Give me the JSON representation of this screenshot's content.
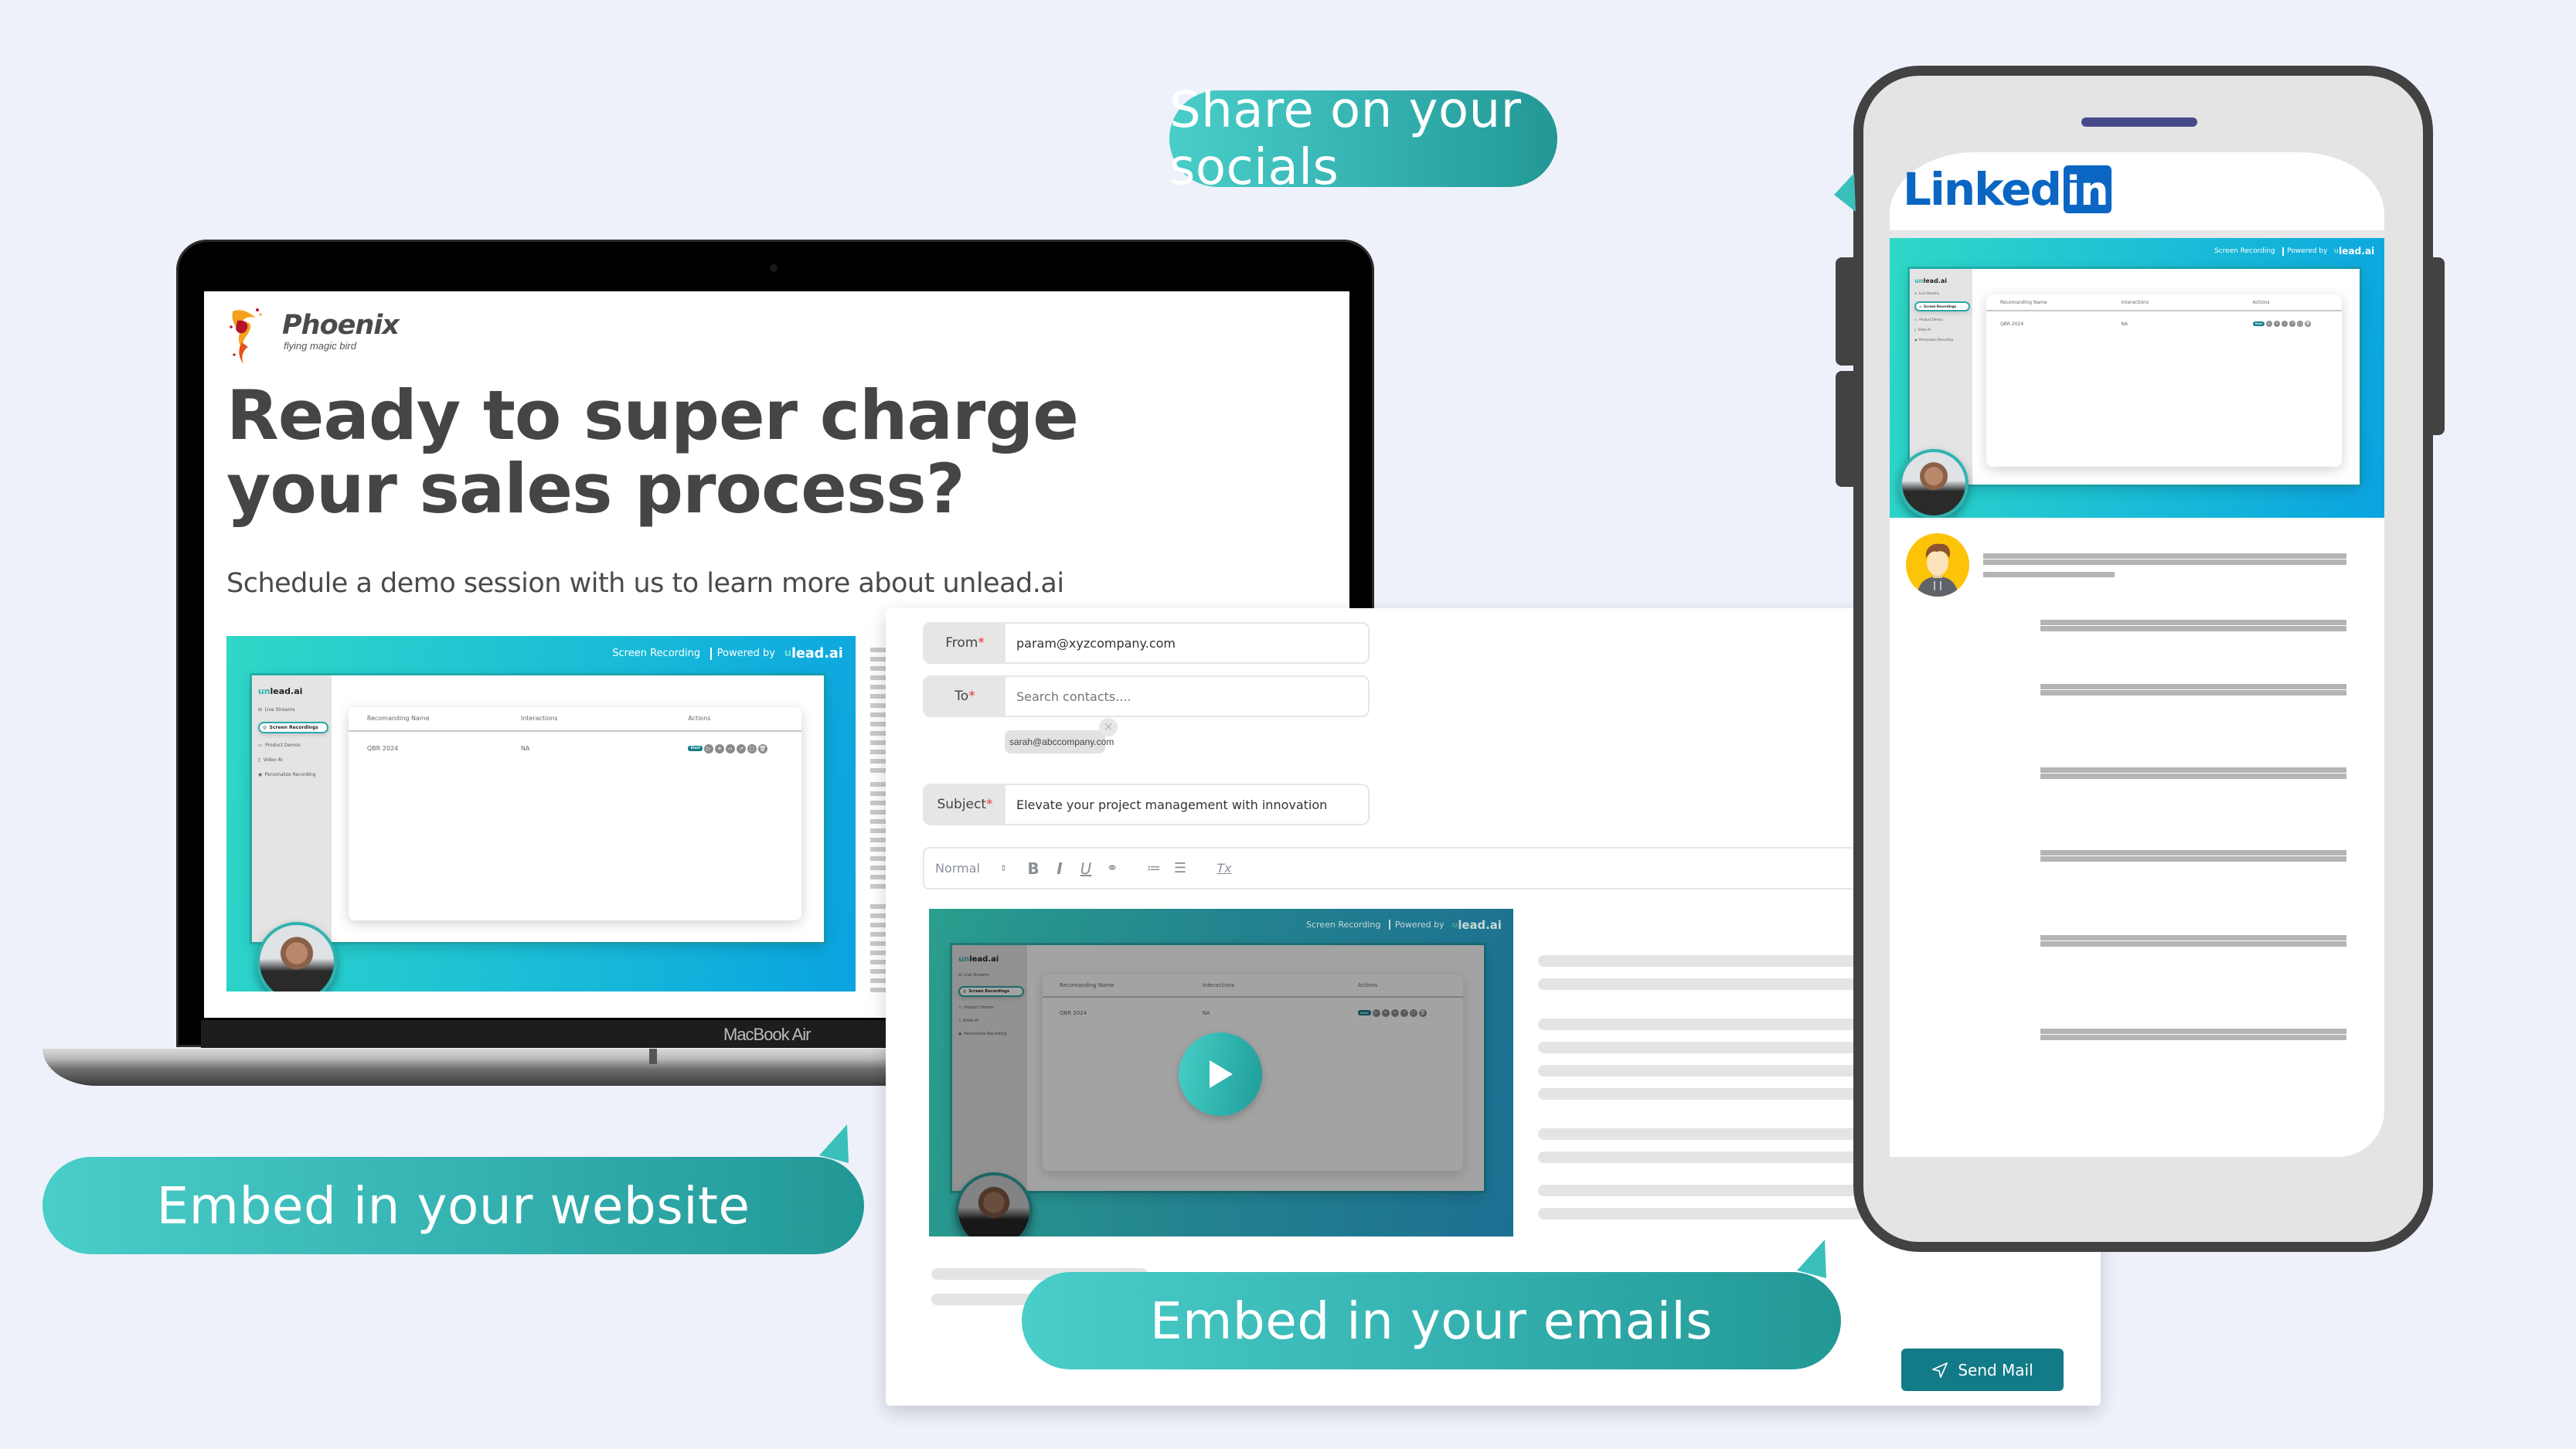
{
  "colors": {
    "background": "#eef1fa",
    "teal_callout_start": "#49cec9",
    "teal_callout_end": "#229896",
    "send_button": "#137b87",
    "linkedin_blue": "#0a66c2",
    "required_star": "#e53935"
  },
  "callouts": {
    "socials": "Share on your socials",
    "website": "Embed in your website",
    "emails": "Embed in your emails"
  },
  "laptop": {
    "model_label": "MacBook Air",
    "site": {
      "brand_name": "Phoenix",
      "brand_tagline": "flying magic bird",
      "headline": "Ready to super charge your sales process?",
      "subheadline": "Schedule a demo session with us to learn more about unlead.ai"
    }
  },
  "recording": {
    "header_label": "Screen Recording",
    "powered_by": "Powered by",
    "logo_u": "u",
    "logo_text": "lead.ai",
    "app_brand_prefix": "un",
    "app_brand_suffix": "lead.ai",
    "sidebar": [
      {
        "label": "Live Streams",
        "icon": "monitor-icon",
        "glyph": "⊟",
        "active": false
      },
      {
        "label": "Screen Recordings",
        "icon": "camera-icon",
        "glyph": "◎",
        "active": true
      },
      {
        "label": "Product Demos",
        "icon": "video-icon",
        "glyph": "▭",
        "active": false
      },
      {
        "label": "Video AI",
        "icon": "file-icon",
        "glyph": "▯",
        "active": false
      },
      {
        "label": "Personalize Recording",
        "icon": "target-icon",
        "glyph": "◉",
        "active": false
      }
    ],
    "table": {
      "columns": [
        "Recomanding Name",
        "Interactions",
        "Actions"
      ],
      "rows": [
        {
          "name": "QBR 2024",
          "interactions": "NA"
        }
      ],
      "actions": [
        {
          "name": "start",
          "label": "Start"
        },
        {
          "name": "play",
          "glyph": "▷"
        },
        {
          "name": "link",
          "glyph": "⚭"
        },
        {
          "name": "embed",
          "glyph": "‹›"
        },
        {
          "name": "share",
          "glyph": "↗"
        },
        {
          "name": "copy",
          "glyph": "▢"
        },
        {
          "name": "delete",
          "glyph": "🗑"
        }
      ]
    }
  },
  "email": {
    "from_label": "From",
    "from_value": "param@xyzcompany.com",
    "to_label": "To",
    "to_placeholder": "Search contacts....",
    "recipient_chip": "sarah@abccompany.com",
    "chip_remove_glyph": "×",
    "subject_label": "Subject",
    "subject_value": "Elevate your project management with innovation",
    "required_marker": "*",
    "toolbar": {
      "format_select": "Normal",
      "bold": "B",
      "italic": "I",
      "underline": "U",
      "link": "⚭",
      "ordered_list": "≔",
      "bullet_list": "☰",
      "clear_format": "Tx"
    },
    "send_label": "Send Mail"
  },
  "phone": {
    "linkedin_word": "Linked",
    "linkedin_box": "in"
  }
}
